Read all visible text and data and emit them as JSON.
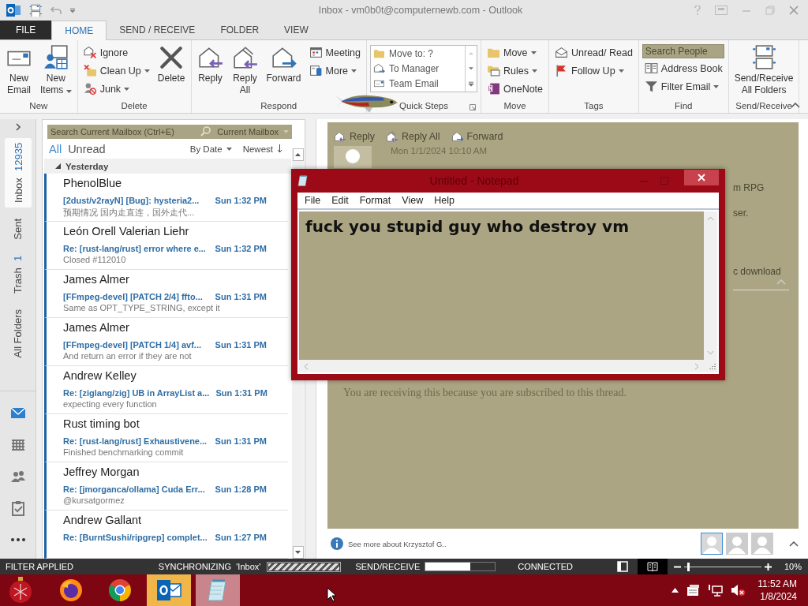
{
  "window": {
    "title": "Inbox - vm0b0t@computernewb.com - Outlook"
  },
  "ribbon_tabs": [
    {
      "label": "FILE",
      "kind": "file",
      "selected": false
    },
    {
      "label": "HOME",
      "kind": "tab",
      "selected": true
    },
    {
      "label": "SEND / RECEIVE",
      "kind": "tab",
      "selected": false
    },
    {
      "label": "FOLDER",
      "kind": "tab",
      "selected": false
    },
    {
      "label": "VIEW",
      "kind": "tab",
      "selected": false
    }
  ],
  "ribbon": [
    {
      "label": "New",
      "columns": [
        {
          "kind": "large",
          "label": "New Email",
          "dropdown": false
        },
        {
          "kind": "large",
          "label": "New Items",
          "dropdown": true
        }
      ]
    },
    {
      "label": "Delete",
      "columns": [
        {
          "kind": "stack",
          "items": [
            {
              "kind": "button",
              "label": "Ignore",
              "dropdown": false
            },
            {
              "kind": "button",
              "label": "Clean Up",
              "dropdown": true
            },
            {
              "kind": "button",
              "label": "Junk",
              "dropdown": true
            }
          ]
        },
        {
          "kind": "large",
          "label": "Delete",
          "dropdown": false
        }
      ]
    },
    {
      "label": "Respond",
      "columns": [
        {
          "kind": "large",
          "label": "Reply",
          "dropdown": false
        },
        {
          "kind": "large",
          "label": "Reply All",
          "dropdown": false
        },
        {
          "kind": "large",
          "label": "Forward",
          "dropdown": false
        },
        {
          "kind": "stack",
          "items": [
            {
              "kind": "button",
              "label": "Meeting",
              "dropdown": false
            },
            {
              "kind": "button",
              "label": "More",
              "dropdown": true
            }
          ]
        }
      ]
    },
    {
      "label": "Quick Steps",
      "columns": [
        {
          "kind": "gallery",
          "items": [
            {
              "label": "Move to: ?"
            },
            {
              "label": "To Manager"
            },
            {
              "label": "Team Email"
            }
          ]
        }
      ]
    },
    {
      "label": "Move",
      "columns": [
        {
          "kind": "stack",
          "items": [
            {
              "kind": "button",
              "label": "Move",
              "dropdown": true
            },
            {
              "kind": "button",
              "label": "Rules",
              "dropdown": true
            },
            {
              "kind": "button",
              "label": "OneNote",
              "dropdown": false
            }
          ]
        }
      ]
    },
    {
      "label": "Tags",
      "columns": [
        {
          "kind": "stack",
          "items": [
            {
              "kind": "button",
              "label": "Unread/ Read",
              "dropdown": false
            },
            {
              "kind": "button",
              "label": "Follow Up",
              "dropdown": true
            }
          ]
        }
      ]
    },
    {
      "label": "Find",
      "columns": [
        {
          "kind": "stack",
          "items": [
            {
              "kind": "search",
              "placeholder": "Search People"
            },
            {
              "kind": "button",
              "label": "Address Book",
              "dropdown": false
            },
            {
              "kind": "button",
              "label": "Filter Email",
              "dropdown": true
            }
          ]
        }
      ]
    },
    {
      "label": "Send/Receive",
      "columns": [
        {
          "kind": "large",
          "label": "Send/Receive All Folders",
          "dropdown": false
        }
      ]
    }
  ],
  "folders": [
    {
      "label": "Inbox",
      "count": "12935",
      "selected": true
    },
    {
      "label": "Sent",
      "selected": false
    },
    {
      "label": "Trash",
      "count": "1",
      "selected": false
    },
    {
      "label": "All Folders",
      "selected": false
    }
  ],
  "nav_icons": [
    {
      "selected": true
    },
    {
      "selected": false
    },
    {
      "selected": false
    },
    {
      "selected": false
    },
    {
      "selected": false
    }
  ],
  "mail_list": {
    "search": {
      "placeholder": "Search Current Mailbox (Ctrl+E)",
      "scope": "Current Mailbox"
    },
    "filters": [
      {
        "label": "All",
        "selected": true
      },
      {
        "label": "Unread",
        "selected": false
      }
    ],
    "sort": "By Date",
    "order": "Newest",
    "group": "Yesterday",
    "messages": [
      {
        "sender": "PhenolBlue",
        "subject": "[2dust/v2rayN] [Bug]: hysteria2...",
        "time": "Sun 1:32 PM",
        "preview": "预期情况 国内走直连，国外走代...",
        "unread": true
      },
      {
        "sender": "León Orell Valerian Liehr",
        "subject": "Re: [rust-lang/rust] error where e...",
        "time": "Sun 1:32 PM",
        "preview": "Closed #112010",
        "unread": true
      },
      {
        "sender": "James Almer",
        "subject": "[FFmpeg-devel] [PATCH 2/4] ffto...",
        "time": "Sun 1:31 PM",
        "preview": "Same as OPT_TYPE_STRING, except it",
        "unread": true
      },
      {
        "sender": "James Almer",
        "subject": "[FFmpeg-devel] [PATCH 1/4] avf...",
        "time": "Sun 1:31 PM",
        "preview": "And return an error if they are not",
        "unread": true
      },
      {
        "sender": "Andrew Kelley",
        "subject": "Re: [ziglang/zig] UB in ArrayList a...",
        "time": "Sun 1:31 PM",
        "preview": "expecting every function",
        "unread": true
      },
      {
        "sender": "Rust timing bot",
        "subject": "Re: [rust-lang/rust] Exhaustivene...",
        "time": "Sun 1:31 PM",
        "preview": "Finished benchmarking commit",
        "unread": true
      },
      {
        "sender": "Jeffrey Morgan",
        "subject": "Re: [jmorganca/ollama] Cuda Err...",
        "time": "Sun 1:28 PM",
        "preview": "@kursatgormez",
        "unread": true
      },
      {
        "sender": "Andrew Gallant",
        "subject": "Re: [BurntSushi/ripgrep] complet...",
        "time": "Sun 1:27 PM",
        "unread": true
      }
    ]
  },
  "reading_pane": {
    "actions": [
      {
        "label": "Reply"
      },
      {
        "label": "Reply All"
      },
      {
        "label": "Forward"
      }
    ],
    "date": "Mon 1/1/2024 10:10 AM",
    "fragments": [
      "m RPG",
      "ser.",
      "c download"
    ],
    "footer_note": "You are receiving this because you are subscribed to this thread.",
    "people_note": "See more about Krzysztof G..",
    "people": [
      {
        "selected": true
      },
      {
        "selected": false
      },
      {
        "selected": false
      }
    ]
  },
  "notepad": {
    "title": "Untitled - Notepad",
    "menus": [
      "File",
      "Edit",
      "Format",
      "View",
      "Help"
    ],
    "text": "fuck you stupid guy who destroy vm"
  },
  "status_bar": {
    "filter": "FILTER APPLIED",
    "sync": "SYNCHRONIZING  'Inbox'",
    "sync_progress": {
      "level": 1
    },
    "send_receive": {
      "label": "SEND/RECEIVE",
      "level": 0.65
    },
    "connection": "CONNECTED",
    "views": [
      {
        "selected": false
      },
      {
        "selected": true
      }
    ],
    "zoom": {
      "level": 0.04,
      "label": "10%"
    }
  },
  "taskbar": {
    "apps": [
      {
        "kind": "start",
        "selected": false,
        "hovered": false
      },
      {
        "kind": "firefox",
        "selected": false,
        "hovered": false
      },
      {
        "kind": "chrome",
        "selected": false,
        "hovered": false
      },
      {
        "kind": "outlook",
        "selected": true,
        "hovered": false
      },
      {
        "kind": "notepad",
        "selected": false,
        "hovered": true
      }
    ],
    "clock": {
      "time": "11:52 AM",
      "date": "1/8/2024"
    }
  }
}
